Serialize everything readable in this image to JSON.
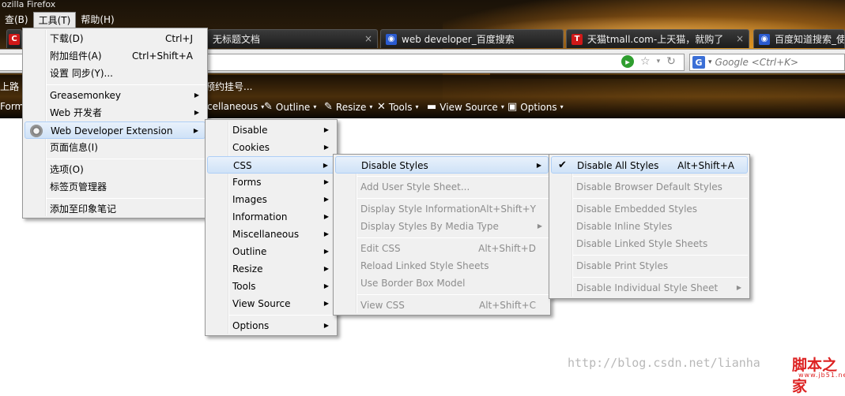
{
  "window": {
    "title": "ozilla Firefox"
  },
  "menubar": {
    "items": [
      "查(B)",
      "工具(T)",
      "帮助(H)"
    ]
  },
  "tabs": [
    {
      "label": "",
      "icon": "firefox-red-icon"
    },
    {
      "label": "无标题文档"
    },
    {
      "label": "web developer_百度搜索"
    },
    {
      "label": "天猫tmall.com-上天猫，就购了"
    },
    {
      "label": "百度知道搜索_使用"
    }
  ],
  "search": {
    "placeholder": "Google <Ctrl+K>",
    "engine": "G"
  },
  "bookmarks": {
    "item1": "上路",
    "item2": "预约挂号..."
  },
  "wd_toolbar": {
    "forms": "Form",
    "miscellaneous": "cellaneous",
    "outline": "Outline",
    "resize": "Resize",
    "tools": "Tools",
    "view_source": "View Source",
    "options": "Options"
  },
  "tools_menu": {
    "items": [
      {
        "label": "下载(D)",
        "shortcut": "Ctrl+J"
      },
      {
        "label": "附加组件(A)",
        "shortcut": "Ctrl+Shift+A"
      },
      {
        "label": "设置 同步(Y)..."
      },
      {
        "label": "Greasemonkey"
      },
      {
        "label": "Web 开发者"
      },
      {
        "label": "Web Developer Extension"
      },
      {
        "label": "页面信息(I)"
      },
      {
        "label": "选项(O)"
      },
      {
        "label": "标签页管理器"
      },
      {
        "label": "添加至印象笔记"
      }
    ]
  },
  "wd_menu": {
    "items": [
      "Disable",
      "Cookies",
      "CSS",
      "Forms",
      "Images",
      "Information",
      "Miscellaneous",
      "Outline",
      "Resize",
      "Tools",
      "View Source",
      "Options"
    ]
  },
  "css_menu": {
    "items": [
      {
        "label": "Disable Styles",
        "shortcut": ""
      },
      {
        "label": "Add User Style Sheet...",
        "shortcut": ""
      },
      {
        "label": "Display Style Information",
        "shortcut": "Alt+Shift+Y"
      },
      {
        "label": "Display Styles By Media Type",
        "shortcut": ""
      },
      {
        "label": "Edit CSS",
        "shortcut": "Alt+Shift+D"
      },
      {
        "label": "Reload Linked Style Sheets",
        "shortcut": ""
      },
      {
        "label": "Use Border Box Model",
        "shortcut": ""
      },
      {
        "label": "View CSS",
        "shortcut": "Alt+Shift+C"
      }
    ]
  },
  "disable_styles_menu": {
    "items": [
      {
        "label": "Disable All Styles",
        "shortcut": "Alt+Shift+A",
        "checked": true
      },
      {
        "label": "Disable Browser Default Styles"
      },
      {
        "label": "Disable Embedded Styles"
      },
      {
        "label": "Disable Inline Styles"
      },
      {
        "label": "Disable Linked Style Sheets"
      },
      {
        "label": "Disable Print Styles"
      },
      {
        "label": "Disable Individual Style Sheet"
      }
    ]
  },
  "watermark": {
    "url": "http://blog.csdn.net/lianha",
    "brand": "脚本之家",
    "brand_url": "www.jb51.net"
  },
  "colors": {
    "highlight": "#cfe2f7",
    "menu_bg": "#f0f0f0",
    "disabled_text": "#8d8d8d",
    "brand_red": "#dd2222"
  }
}
